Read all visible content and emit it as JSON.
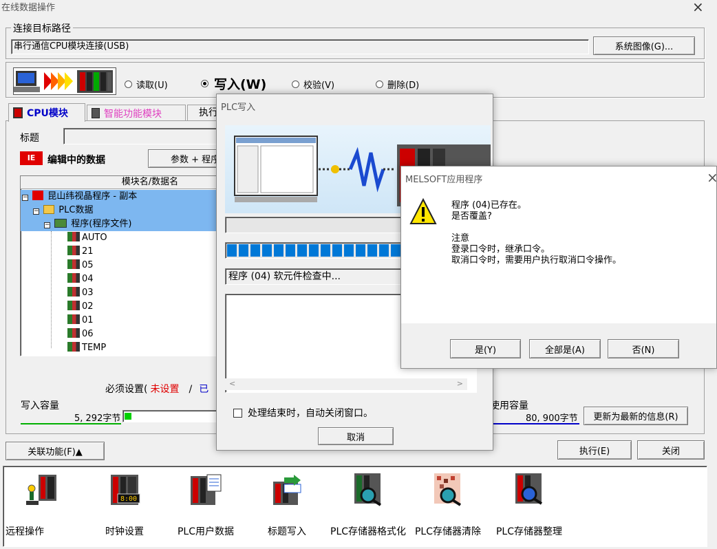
{
  "window": {
    "title": "在线数据操作"
  },
  "connection": {
    "group_label": "连接目标路径",
    "path_value": "串行通信CPU模块连接(USB)",
    "system_image_button": "系统图像(G)..."
  },
  "operation": {
    "read": "读取(U)",
    "write": "写入(W)",
    "verify": "校验(V)",
    "delete": "删除(D)",
    "selected": "write"
  },
  "tabs": [
    {
      "label": "CPU模块",
      "color": "#0000c8"
    },
    {
      "label": "智能功能模块",
      "color": "#e040c0"
    },
    {
      "label": "执行"
    }
  ],
  "main": {
    "title_label": "标题",
    "editing_data_label": "编辑中的数据",
    "param_prog_button": "参数 + 程序",
    "tree_header": "模块名/数据名",
    "tree": {
      "root": "昆山纬视晶程序 - 副本",
      "plc_data": "PLC数据",
      "program_folder": "程序(程序文件)",
      "programs": [
        "AUTO",
        "21",
        "05",
        "04",
        "03",
        "02",
        "01",
        "06",
        "TEMP"
      ]
    },
    "required_settings_prefix": "必须设置(",
    "required_settings_value": "未设置",
    "required_settings_sep": "/",
    "required_settings_trunc": "已",
    "write_capacity_label": "写入容量",
    "write_capacity_value": "5, 292字节",
    "used_capacity_label": "使用容量",
    "used_capacity_value": "80, 900字节",
    "refresh_button": "更新为最新的信息(R)",
    "related_func_button": "关联功能(F)▲",
    "execute_button": "执行(E)",
    "close_button": "关闭"
  },
  "functions": [
    {
      "label": "远程操作",
      "icon": "remote-operation-icon"
    },
    {
      "label": "时钟设置",
      "icon": "clock-setting-icon"
    },
    {
      "label": "PLC用户数据",
      "icon": "plc-user-data-icon"
    },
    {
      "label": "标题写入",
      "icon": "title-write-icon"
    },
    {
      "label": "PLC存储器格式化",
      "icon": "memory-format-icon"
    },
    {
      "label": "PLC存储器清除",
      "icon": "memory-clear-icon"
    },
    {
      "label": "PLC存储器整理",
      "icon": "memory-arrange-icon"
    }
  ],
  "plc_write_dialog": {
    "title": "PLC写入",
    "progress": 0.85,
    "status_text": "程序 (04) 软元件检查中...",
    "auto_close_label": "处理结束时，自动关闭窗口。",
    "cancel_button": "取消"
  },
  "melsoft_dialog": {
    "title": "MELSOFT应用程序",
    "line1": "程序 (04)已存在。",
    "line2": "是否覆盖?",
    "note_title": "注意",
    "note1": "登录口令时，继承口令。",
    "note2": "取消口令时，需要用户执行取消口令操作。",
    "yes_button": "是(Y)",
    "yes_all_button": "全部是(A)",
    "no_button": "否(N)"
  },
  "colors": {
    "accent_blue": "#3399ff",
    "progress_blue": "#0078d7",
    "warning_yellow": "#ffe600",
    "error_red": "#e00000"
  }
}
